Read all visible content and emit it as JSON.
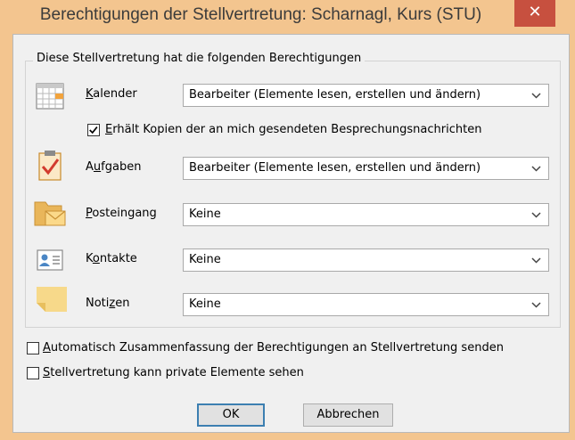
{
  "window": {
    "title": "Berechtigungen der Stellvertretung: Scharnagl, Kurs (STU)",
    "close_glyph": "✕",
    "accent": "#f3c58f"
  },
  "group": {
    "legend": "Diese Stellvertretung hat die folgenden Berechtigungen"
  },
  "rows": [
    {
      "icon": "calendar-icon",
      "label_u": "K",
      "label_rest": "alender",
      "value": "Bearbeiter (Elemente lesen, erstellen und ändern)"
    },
    {
      "icon": "tasks-icon",
      "label_pre": "A",
      "label_u": "u",
      "label_rest": "fgaben",
      "value": "Bearbeiter (Elemente lesen, erstellen und ändern)"
    },
    {
      "icon": "inbox-icon",
      "label_u": "P",
      "label_rest": "osteingang",
      "value": "Keine"
    },
    {
      "icon": "contacts-icon",
      "label_pre": "K",
      "label_u": "o",
      "label_rest": "ntakte",
      "value": "Keine"
    },
    {
      "icon": "notes-icon",
      "label_pre": "Noti",
      "label_u": "z",
      "label_rest": "en",
      "value": "Keine"
    }
  ],
  "copies_checkbox": {
    "checked": true,
    "label_u": "E",
    "label_rest": "rhält Kopien der an mich gesendeten Besprechungsnachrichten"
  },
  "summary_checkbox": {
    "checked": false,
    "label_u": "A",
    "label_rest": "utomatisch Zusammenfassung der Berechtigungen an Stellvertretung senden"
  },
  "private_checkbox": {
    "checked": false,
    "label_u": "S",
    "label_rest": "tellvertretung kann private Elemente sehen"
  },
  "buttons": {
    "ok": "OK",
    "cancel": "Abbrechen"
  }
}
